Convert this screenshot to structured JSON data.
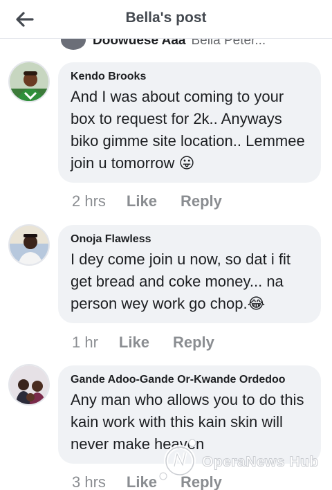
{
  "header": {
    "title": "Bella's post"
  },
  "previous_comment": {
    "author_partial": "Doowuese Aaa",
    "tag_partial": "Bella Peter..."
  },
  "comments": [
    {
      "author": "Kendo Brooks",
      "text": "And I was about coming to your box to request for 2k..  Anyways biko gimme site location.. Lemmee join u tomorrow",
      "emoji": "😛",
      "time": "2 hrs",
      "like_label": "Like",
      "reply_label": "Reply"
    },
    {
      "author": "Onoja Flawless",
      "text": "I dey come join u now, so dat i fit get bread and coke money... na person wey work go chop.",
      "emoji": "😂",
      "time": "1 hr",
      "like_label": "Like",
      "reply_label": "Reply"
    },
    {
      "author": "Gande Adoo-Gande Or-Kwande Ordedoo",
      "text": "Any man who allows you to do this kain work with this kain skin will never make heaven",
      "time": "3 hrs",
      "like_label": "Like",
      "reply_label": "Reply"
    }
  ],
  "watermark": {
    "text": "OperaNews Hub"
  },
  "icons": {
    "back": "back-arrow-icon"
  }
}
